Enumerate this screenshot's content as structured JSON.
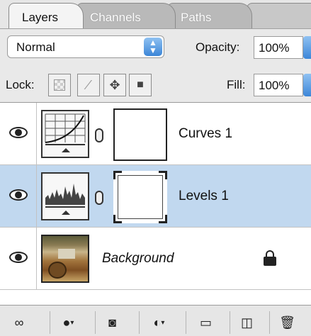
{
  "tabs": [
    {
      "label": "Layers",
      "active": true
    },
    {
      "label": "Channels",
      "active": false
    },
    {
      "label": "Paths",
      "active": false
    }
  ],
  "blend_mode": {
    "value": "Normal"
  },
  "opacity": {
    "label": "Opacity:",
    "value": "100%"
  },
  "lock": {
    "label": "Lock:"
  },
  "fill": {
    "label": "Fill:",
    "value": "100%"
  },
  "layers": [
    {
      "name": "Curves 1",
      "visible": true,
      "selected": false,
      "type": "adjustment-curves"
    },
    {
      "name": "Levels 1",
      "visible": true,
      "selected": true,
      "type": "adjustment-levels"
    },
    {
      "name": "Background",
      "visible": true,
      "selected": false,
      "locked": true,
      "type": "image"
    }
  ],
  "colors": {
    "selection": "#c1d8ef",
    "accent": "#3c86d8"
  },
  "toolbar_icons": [
    "link-layers-icon",
    "layer-style-icon",
    "add-mask-icon",
    "adjustment-layer-icon",
    "new-group-icon",
    "new-layer-icon",
    "trash-icon"
  ]
}
